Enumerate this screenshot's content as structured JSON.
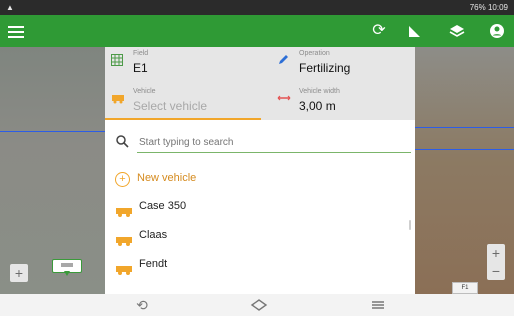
{
  "statusbar": {
    "left_icon": "android-icon",
    "right_text": "76% 10:09"
  },
  "appbar": {
    "menu_icon": "menu-icon",
    "right_icons": [
      "sync-icon",
      "ruler-icon",
      "layers-icon",
      "account-icon"
    ]
  },
  "header": {
    "field_label": "Field",
    "field_value": "E1",
    "operation_label": "Operation",
    "operation_value": "Fertilizing",
    "vehicle_label": "Vehicle",
    "vehicle_placeholder": "Select vehicle",
    "width_label": "Vehicle width",
    "width_value": "3,00 m"
  },
  "sheet": {
    "search_placeholder": "Start typing to search",
    "new_vehicle_label": "New vehicle",
    "items": [
      "Case 350",
      "Claas",
      "Fendt"
    ]
  },
  "map": {
    "zoom_in": "+",
    "zoom_out": "−",
    "left_button": "+",
    "chip_text": "F1"
  },
  "navbar": {
    "back_icon": "back-icon",
    "home_icon": "home-icon",
    "recents_icon": "recents-icon"
  },
  "colors": {
    "appbar": "#2f9a35",
    "accent_orange": "#f1a62b",
    "blue_line": "#2d5de6"
  }
}
